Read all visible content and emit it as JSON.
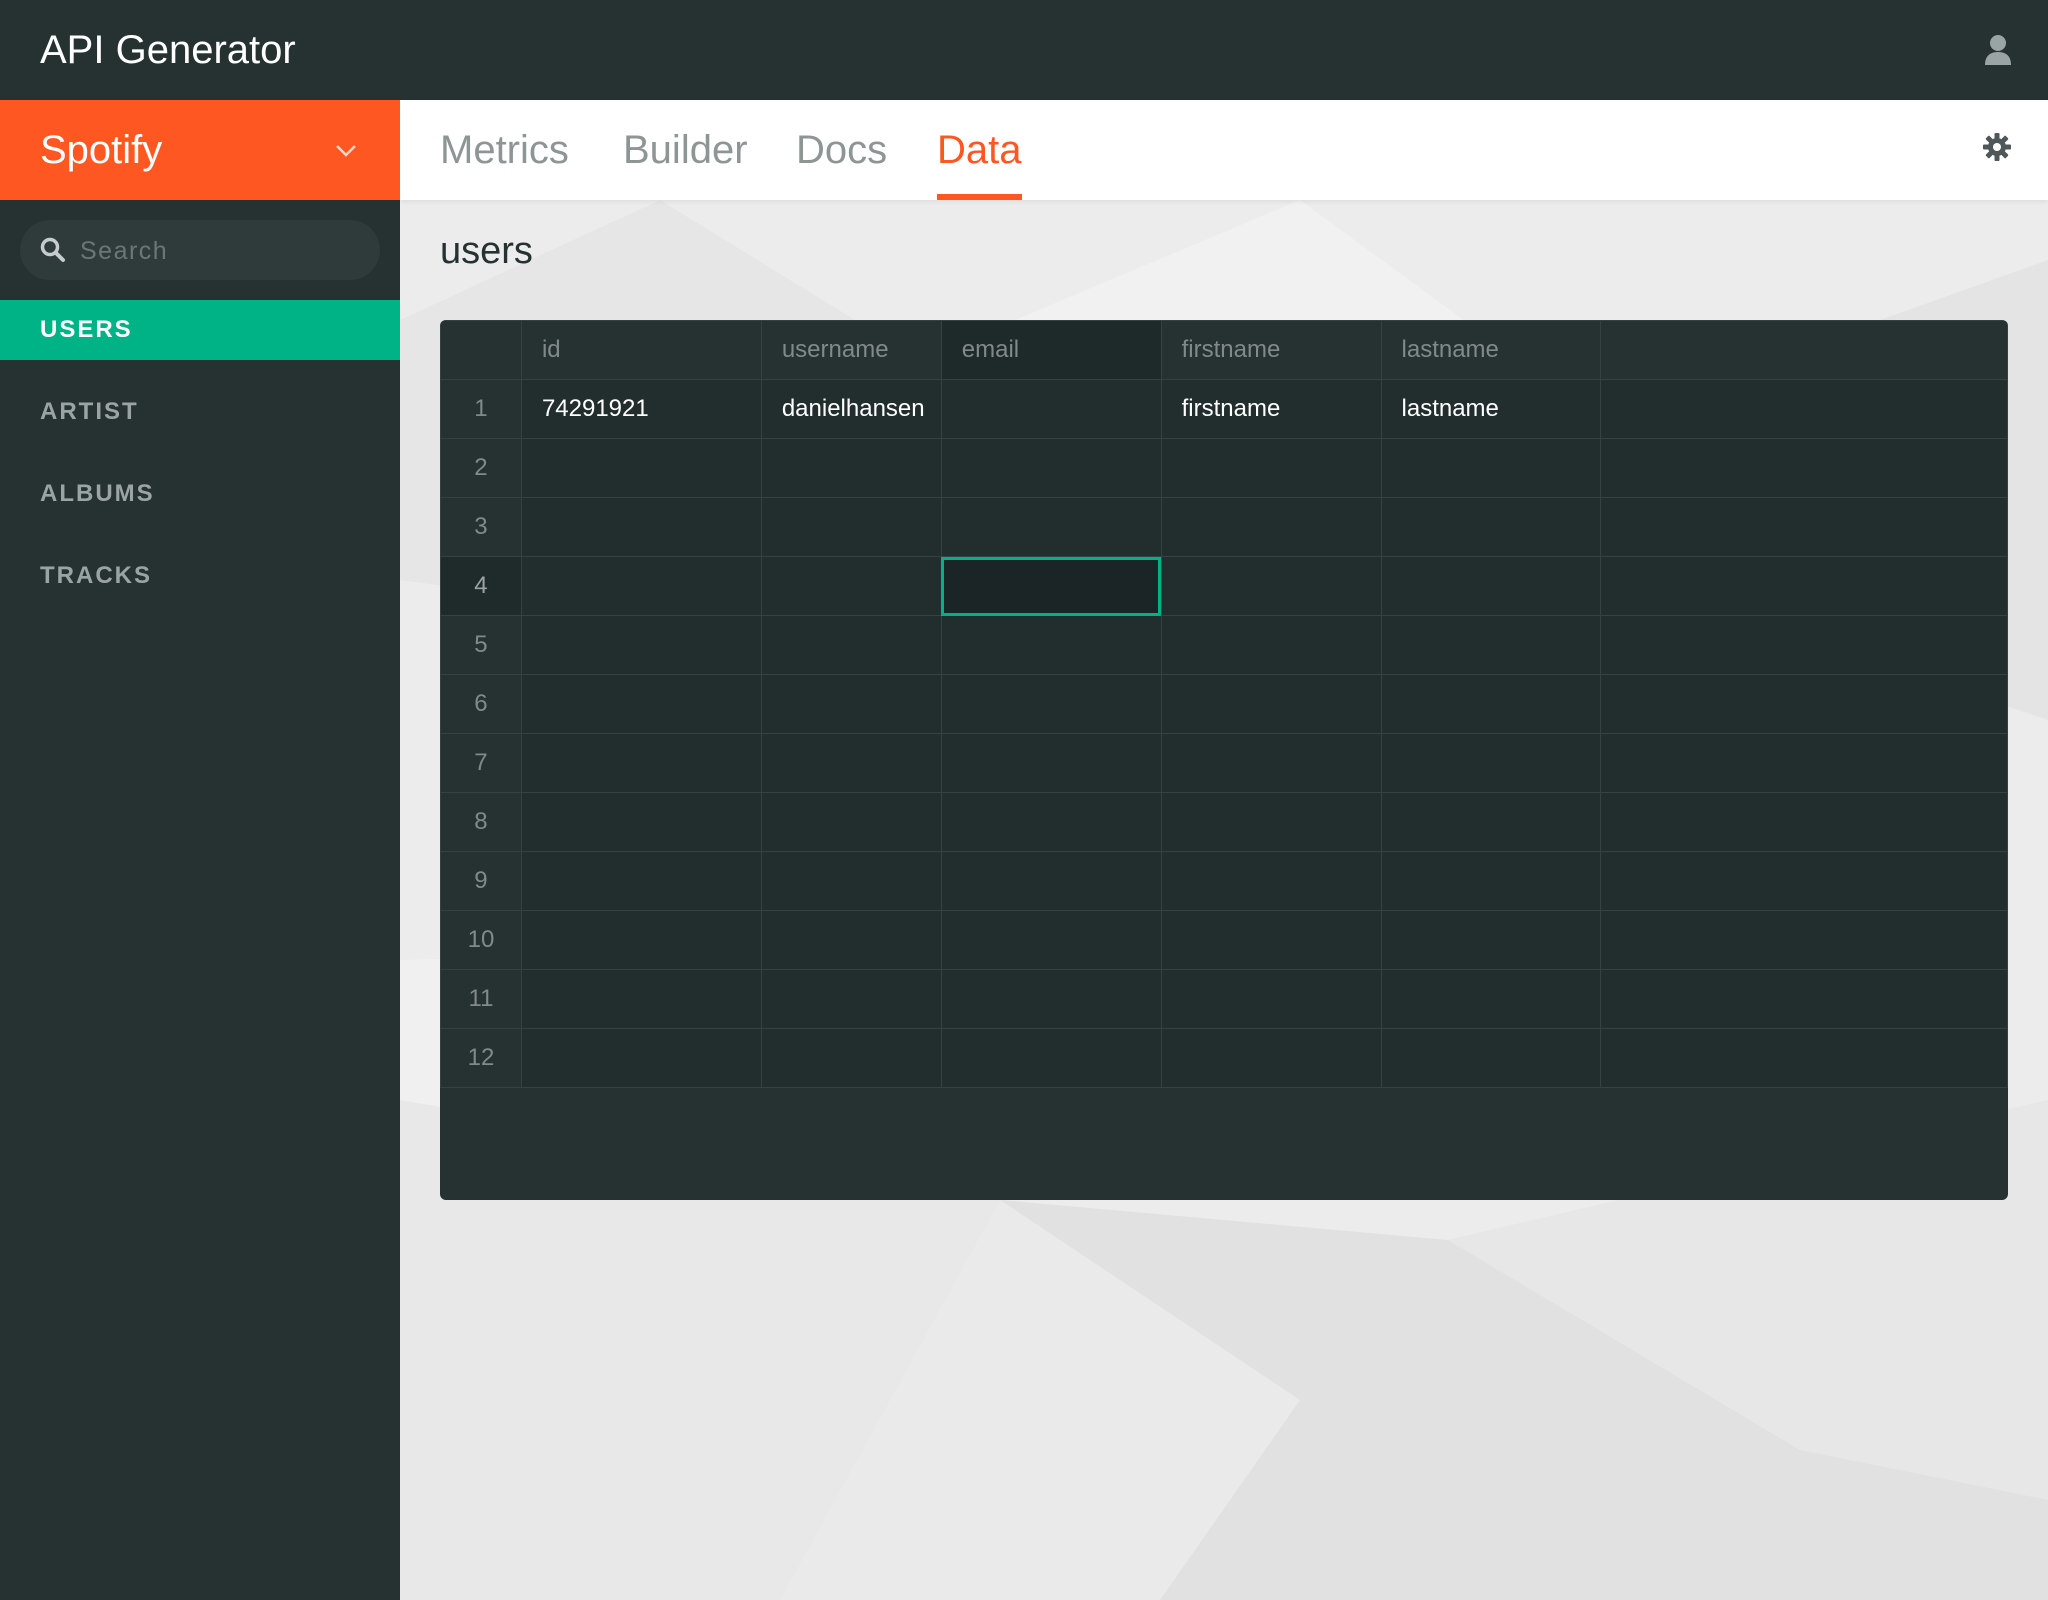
{
  "app": {
    "title": "API Generator"
  },
  "header": {
    "user_icon": "user-icon"
  },
  "sidebar": {
    "project": "Spotify",
    "search": {
      "placeholder": "Search",
      "value": ""
    },
    "items": [
      {
        "label": "USERS",
        "active": true
      },
      {
        "label": "ARTIST",
        "active": false
      },
      {
        "label": "ALBUMS",
        "active": false
      },
      {
        "label": "TRACKS",
        "active": false
      }
    ]
  },
  "tabs": [
    {
      "label": "Metrics",
      "active": false
    },
    {
      "label": "Builder",
      "active": false
    },
    {
      "label": "Docs",
      "active": false
    },
    {
      "label": "Data",
      "active": true
    }
  ],
  "main": {
    "section_title": "users",
    "table": {
      "columns": [
        "id",
        "username",
        "email",
        "firstname",
        "lastname"
      ],
      "row_numbers": [
        "1",
        "2",
        "3",
        "4",
        "5",
        "6",
        "7",
        "8",
        "9",
        "10",
        "11",
        "12"
      ],
      "rows": [
        [
          "74291921",
          "danielhansen",
          "",
          "firstname",
          "lastname"
        ],
        [
          "",
          "",
          "",
          "",
          ""
        ],
        [
          "",
          "",
          "",
          "",
          ""
        ],
        [
          "",
          "",
          "",
          "",
          ""
        ],
        [
          "",
          "",
          "",
          "",
          ""
        ],
        [
          "",
          "",
          "",
          "",
          ""
        ],
        [
          "",
          "",
          "",
          "",
          ""
        ],
        [
          "",
          "",
          "",
          "",
          ""
        ],
        [
          "",
          "",
          "",
          "",
          ""
        ],
        [
          "",
          "",
          "",
          "",
          ""
        ],
        [
          "",
          "",
          "",
          "",
          ""
        ],
        [
          "",
          "",
          "",
          "",
          ""
        ]
      ],
      "selected_row": 4,
      "selected_column": "email"
    }
  },
  "colors": {
    "accent": "#fe5722",
    "active_nav": "#00b386",
    "sidebar_bg": "#263232",
    "selected_cell_border": "#00b386"
  }
}
